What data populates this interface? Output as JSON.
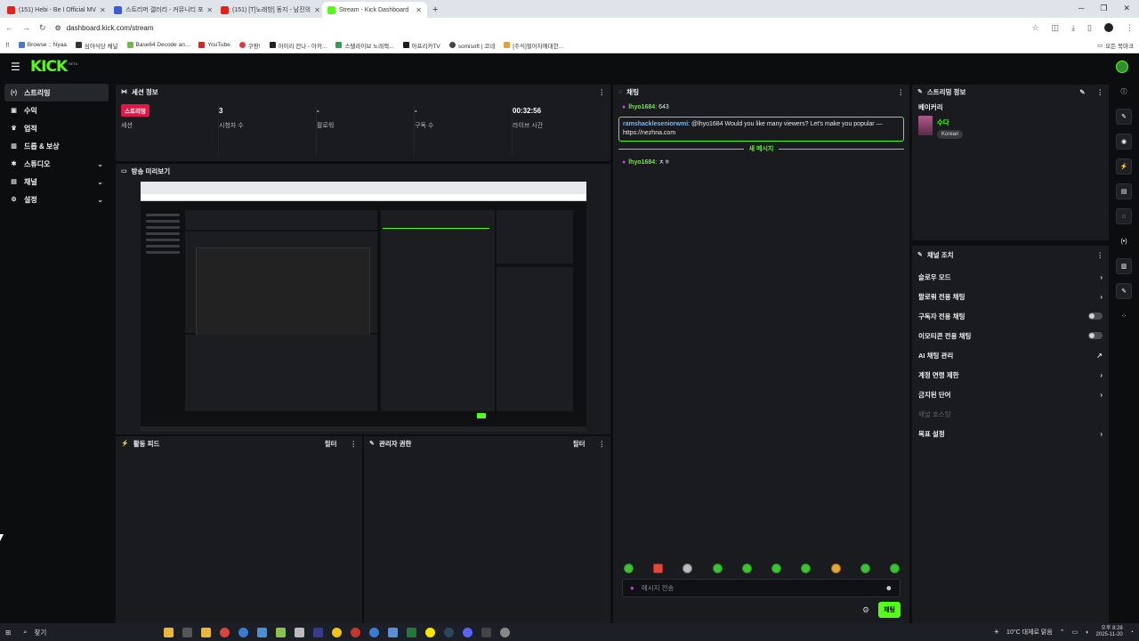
{
  "browser": {
    "tabs": [
      {
        "label": "(151) Hebi - Be I Official MV",
        "color": "#e62117"
      },
      {
        "label": "스트리머 갤러리 - 커뮤니티 포",
        "color": "#3b5bdb"
      },
      {
        "label": "(151) [T]노래방] 동지 - 남진의",
        "color": "#e62117"
      },
      {
        "label": "Stream - Kick Dashboard",
        "color": "#53fc18"
      }
    ],
    "url": "dashboard.kick.com/stream",
    "bookmarks": [
      "Browse :: Nyaa",
      "심야식당 채널",
      "Base64 Decode an...",
      "YouTube",
      "쿠팡!",
      "아이리 칸나 - 아카...",
      "스텔라이브 노래책...",
      "아프리카TV",
      "somisoft | 코네",
      "[주식]헐어차에대한..."
    ],
    "bookmarks_right": "모든 북마크"
  },
  "kick": {
    "logo": "KICK",
    "beta": "BETA"
  },
  "sidebar": {
    "items": [
      {
        "label": "스트리밍",
        "icon": "broadcast-icon",
        "glyph": "(•)"
      },
      {
        "label": "수익",
        "icon": "wallet-icon",
        "glyph": "▣"
      },
      {
        "label": "업적",
        "icon": "trophy-icon",
        "glyph": "🏆"
      },
      {
        "label": "드롭 & 보상",
        "icon": "gift-icon",
        "glyph": "🎁"
      },
      {
        "label": "스튜디오",
        "icon": "studio-icon",
        "glyph": "✱"
      },
      {
        "label": "채널",
        "icon": "channel-icon",
        "glyph": "▤"
      },
      {
        "label": "설정",
        "icon": "gear-icon",
        "glyph": "⚙"
      }
    ]
  },
  "session": {
    "title": "세션 정보",
    "stats": [
      {
        "value": "스트리밍",
        "label": "세션",
        "badge": true
      },
      {
        "value": "3",
        "label": "시청자 수"
      },
      {
        "value": "-",
        "label": "팔로워"
      },
      {
        "value": "-",
        "label": "구독 수"
      },
      {
        "value": "00:32:56",
        "label": "라이브 시간"
      }
    ]
  },
  "preview": {
    "title": "방송 미리보기"
  },
  "activity": {
    "title": "활동 피드",
    "filter": "필터"
  },
  "mods": {
    "title": "관리자 권한",
    "filter": "필터"
  },
  "chat": {
    "title": "채팅",
    "messages": [
      {
        "user": "lhyo1684",
        "text": ": 643"
      },
      {
        "user": "ramshackleseniorwmi",
        "text": ": @lhyo1684 Would you like many viewers? Let's make you popular — https://nezhna.com",
        "highlight": true
      }
    ],
    "new_messages": "새 메시지",
    "after": [
      {
        "user": "lhyo1684",
        "text": ": ㅊㅎ"
      }
    ],
    "input_placeholder": "메시지 전송",
    "send": "채팅"
  },
  "stream_info": {
    "title": "스트리밍 정보",
    "stream_title": "베이커리",
    "category": "수다",
    "tag": "Korean"
  },
  "channel_controls": {
    "title": "채널 조치",
    "items": [
      {
        "label": "슬로우 모드",
        "type": "chevron"
      },
      {
        "label": "팔로워 전용 채팅",
        "type": "chevron"
      },
      {
        "label": "구독자 전용 채팅",
        "type": "toggle"
      },
      {
        "label": "이모티콘 전용 채팅",
        "type": "toggle"
      },
      {
        "label": "AI 채팅 관리",
        "type": "external"
      },
      {
        "label": "계정 연령 제한",
        "type": "chevron"
      },
      {
        "label": "금지된 단어",
        "type": "chevron"
      },
      {
        "label": "채널 호스팅",
        "type": "muted"
      },
      {
        "label": "목표 설정",
        "type": "chevron"
      }
    ]
  },
  "taskbar": {
    "search": "찾기",
    "weather": "10°C 대체로 맑음",
    "time": "오후 8:28",
    "date": "2025-11-20"
  }
}
